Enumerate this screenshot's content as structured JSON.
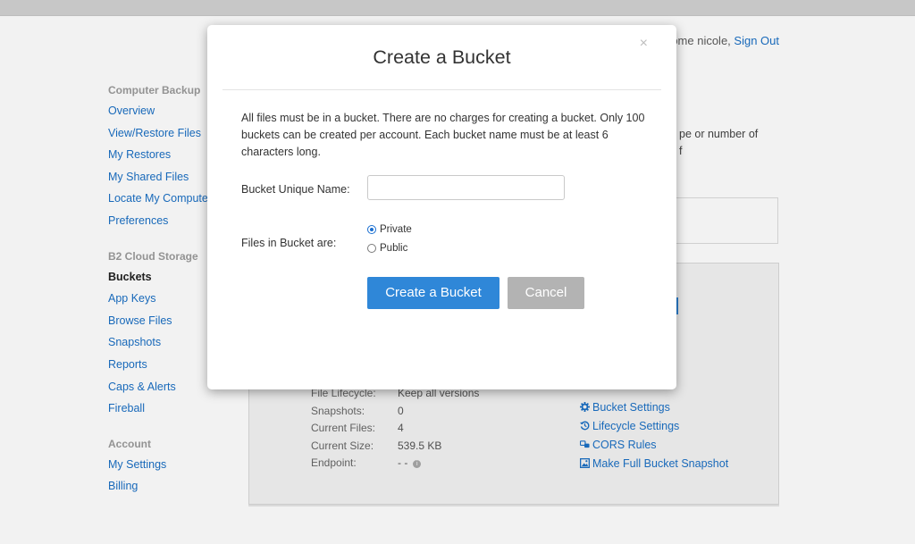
{
  "header": {
    "welcome_text": "come nicole, ",
    "sign_out": "Sign Out"
  },
  "sidebar": {
    "groups": [
      {
        "heading": "Computer Backup",
        "items": [
          "Overview",
          "View/Restore Files",
          "My Restores",
          "My Shared Files",
          "Locate My Computer",
          "Preferences"
        ]
      },
      {
        "heading": "B2 Cloud Storage",
        "items": [
          "Buckets",
          "App Keys",
          "Browse Files",
          "Snapshots",
          "Reports",
          "Caps & Alerts",
          "Fireball"
        ],
        "active": "Buckets"
      },
      {
        "heading": "Account",
        "items": [
          "My Settings",
          "Billing"
        ]
      }
    ]
  },
  "content": {
    "text_line1": "pe or number of",
    "text_line2": "f"
  },
  "bucket_details": {
    "rows": [
      {
        "label": "File Lifecycle:",
        "value": "Keep all versions"
      },
      {
        "label": "Snapshots:",
        "value": "0"
      },
      {
        "label": "Current Files:",
        "value": "4"
      },
      {
        "label": "Current Size:",
        "value": "539.5 KB"
      },
      {
        "label": "Endpoint:",
        "value": "- -"
      }
    ],
    "actions": [
      {
        "label": "Bucket Settings",
        "icon": "gear-icon"
      },
      {
        "label": "Lifecycle Settings",
        "icon": "history-icon"
      },
      {
        "label": "CORS Rules",
        "icon": "cors-icon"
      },
      {
        "label": "Make Full Bucket Snapshot",
        "icon": "snapshot-icon"
      }
    ]
  },
  "modal": {
    "title": "Create a Bucket",
    "close_symbol": "×",
    "description": "All files must be in a bucket. There are no charges for creating a bucket. Only 100 buckets can be created per account. Each bucket name must be at least 6 characters long.",
    "name_label": "Bucket Unique Name:",
    "name_value": "",
    "files_label": "Files in Bucket are:",
    "options": [
      {
        "label": "Private",
        "checked": true
      },
      {
        "label": "Public",
        "checked": false
      }
    ],
    "create_button": "Create a Bucket",
    "cancel_button": "Cancel"
  },
  "colors": {
    "link": "#1a6fc4",
    "primary_button": "#2f87d8",
    "cancel_button": "#b3b3b3"
  }
}
